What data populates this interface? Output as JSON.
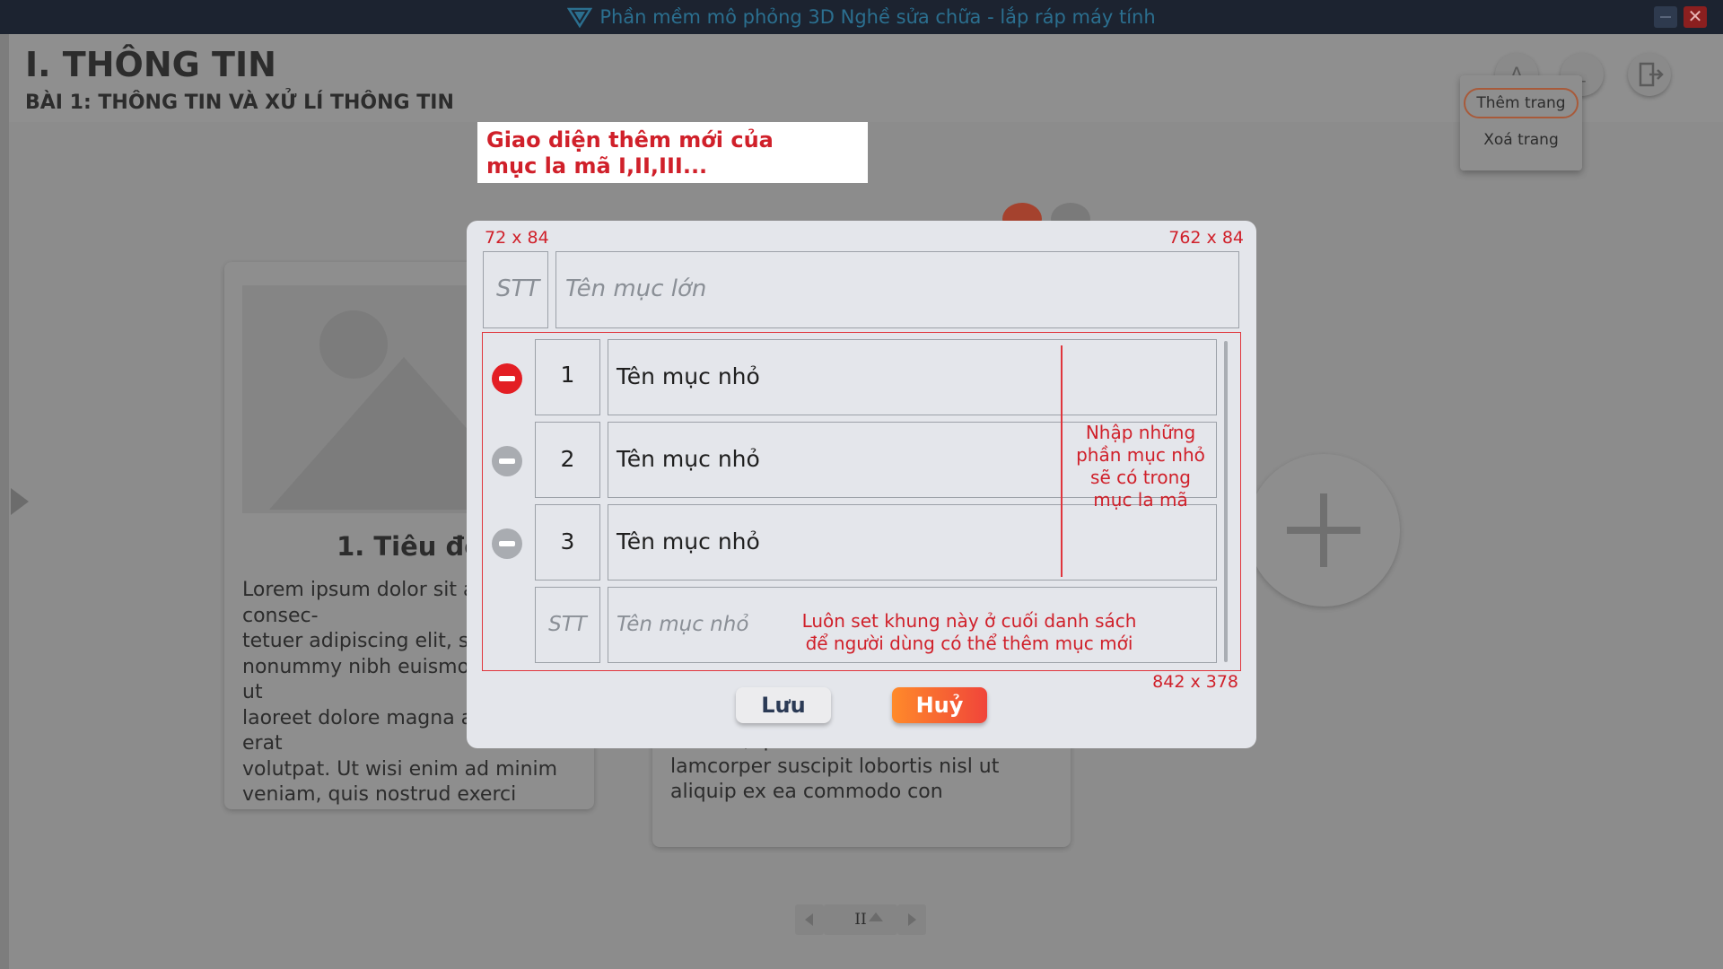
{
  "window": {
    "title": "Phần mềm mô phỏng 3D Nghề sửa chữa - lắp ráp máy tính",
    "minimize_icon": "minimize-icon",
    "close_label": "✕"
  },
  "header": {
    "title": "I. THÔNG TIN",
    "subtitle": "BÀI 1: THÔNG TIN VÀ XỬ LÍ THÔNG TIN"
  },
  "page_menu": {
    "add_page": "Thêm trang",
    "delete_page": "Xoá trang"
  },
  "background_cards": {
    "card1_title": "1. Tiêu đề",
    "card1_text": "Lorem ipsum dolor sit amet, consec-\ntetuer adipiscing elit, sed diam\nnonummy nibh euismod tincidunt ut\nlaoreet dolore magna aliquam erat\nvolutpat. Ut wisi enim ad minim\nveniam, quis nostrud exerci tation\nullamcorper suscipit lobortis nisl ut\naliquip ex ea commodo con",
    "card2_text": "veniam, quis nostrud exerci tation ul-\nlamcorper suscipit lobortis nisl ut\naliquip ex ea commodo con"
  },
  "pager": {
    "label": "II"
  },
  "annotation": {
    "line1": "Giao diện thêm mới của",
    "line2": "mục la mã I,II,III..."
  },
  "modal": {
    "dim_stt": "72 x 84",
    "dim_title": "762 x 84",
    "dim_list": "842 x 378",
    "stt_placeholder": "STT",
    "title_placeholder": "Tên mục lớn",
    "items": [
      {
        "num": "1",
        "name": "Tên mục nhỏ",
        "active": true
      },
      {
        "num": "2",
        "name": "Tên mục nhỏ",
        "active": false
      },
      {
        "num": "3",
        "name": "Tên mục nhỏ",
        "active": false
      }
    ],
    "new_stt_placeholder": "STT",
    "new_name_placeholder": "Tên mục nhỏ",
    "note_right": "Nhập những\nphần mục nhỏ\nsẽ có trong\nmục la mã",
    "note_bottom": "Luôn set khung này ở cuối danh sách\nđể người dùng có thể thêm mục mới",
    "save_label": "Lưu",
    "cancel_label": "Huỷ"
  },
  "colors": {
    "annotation_red": "#d0202a",
    "remove_active": "#e31e24",
    "remove_inactive": "#a9acb1",
    "cancel_gradient_start": "#ff8a2a",
    "cancel_gradient_end": "#f0453a",
    "titlebar": "#1c2330"
  }
}
